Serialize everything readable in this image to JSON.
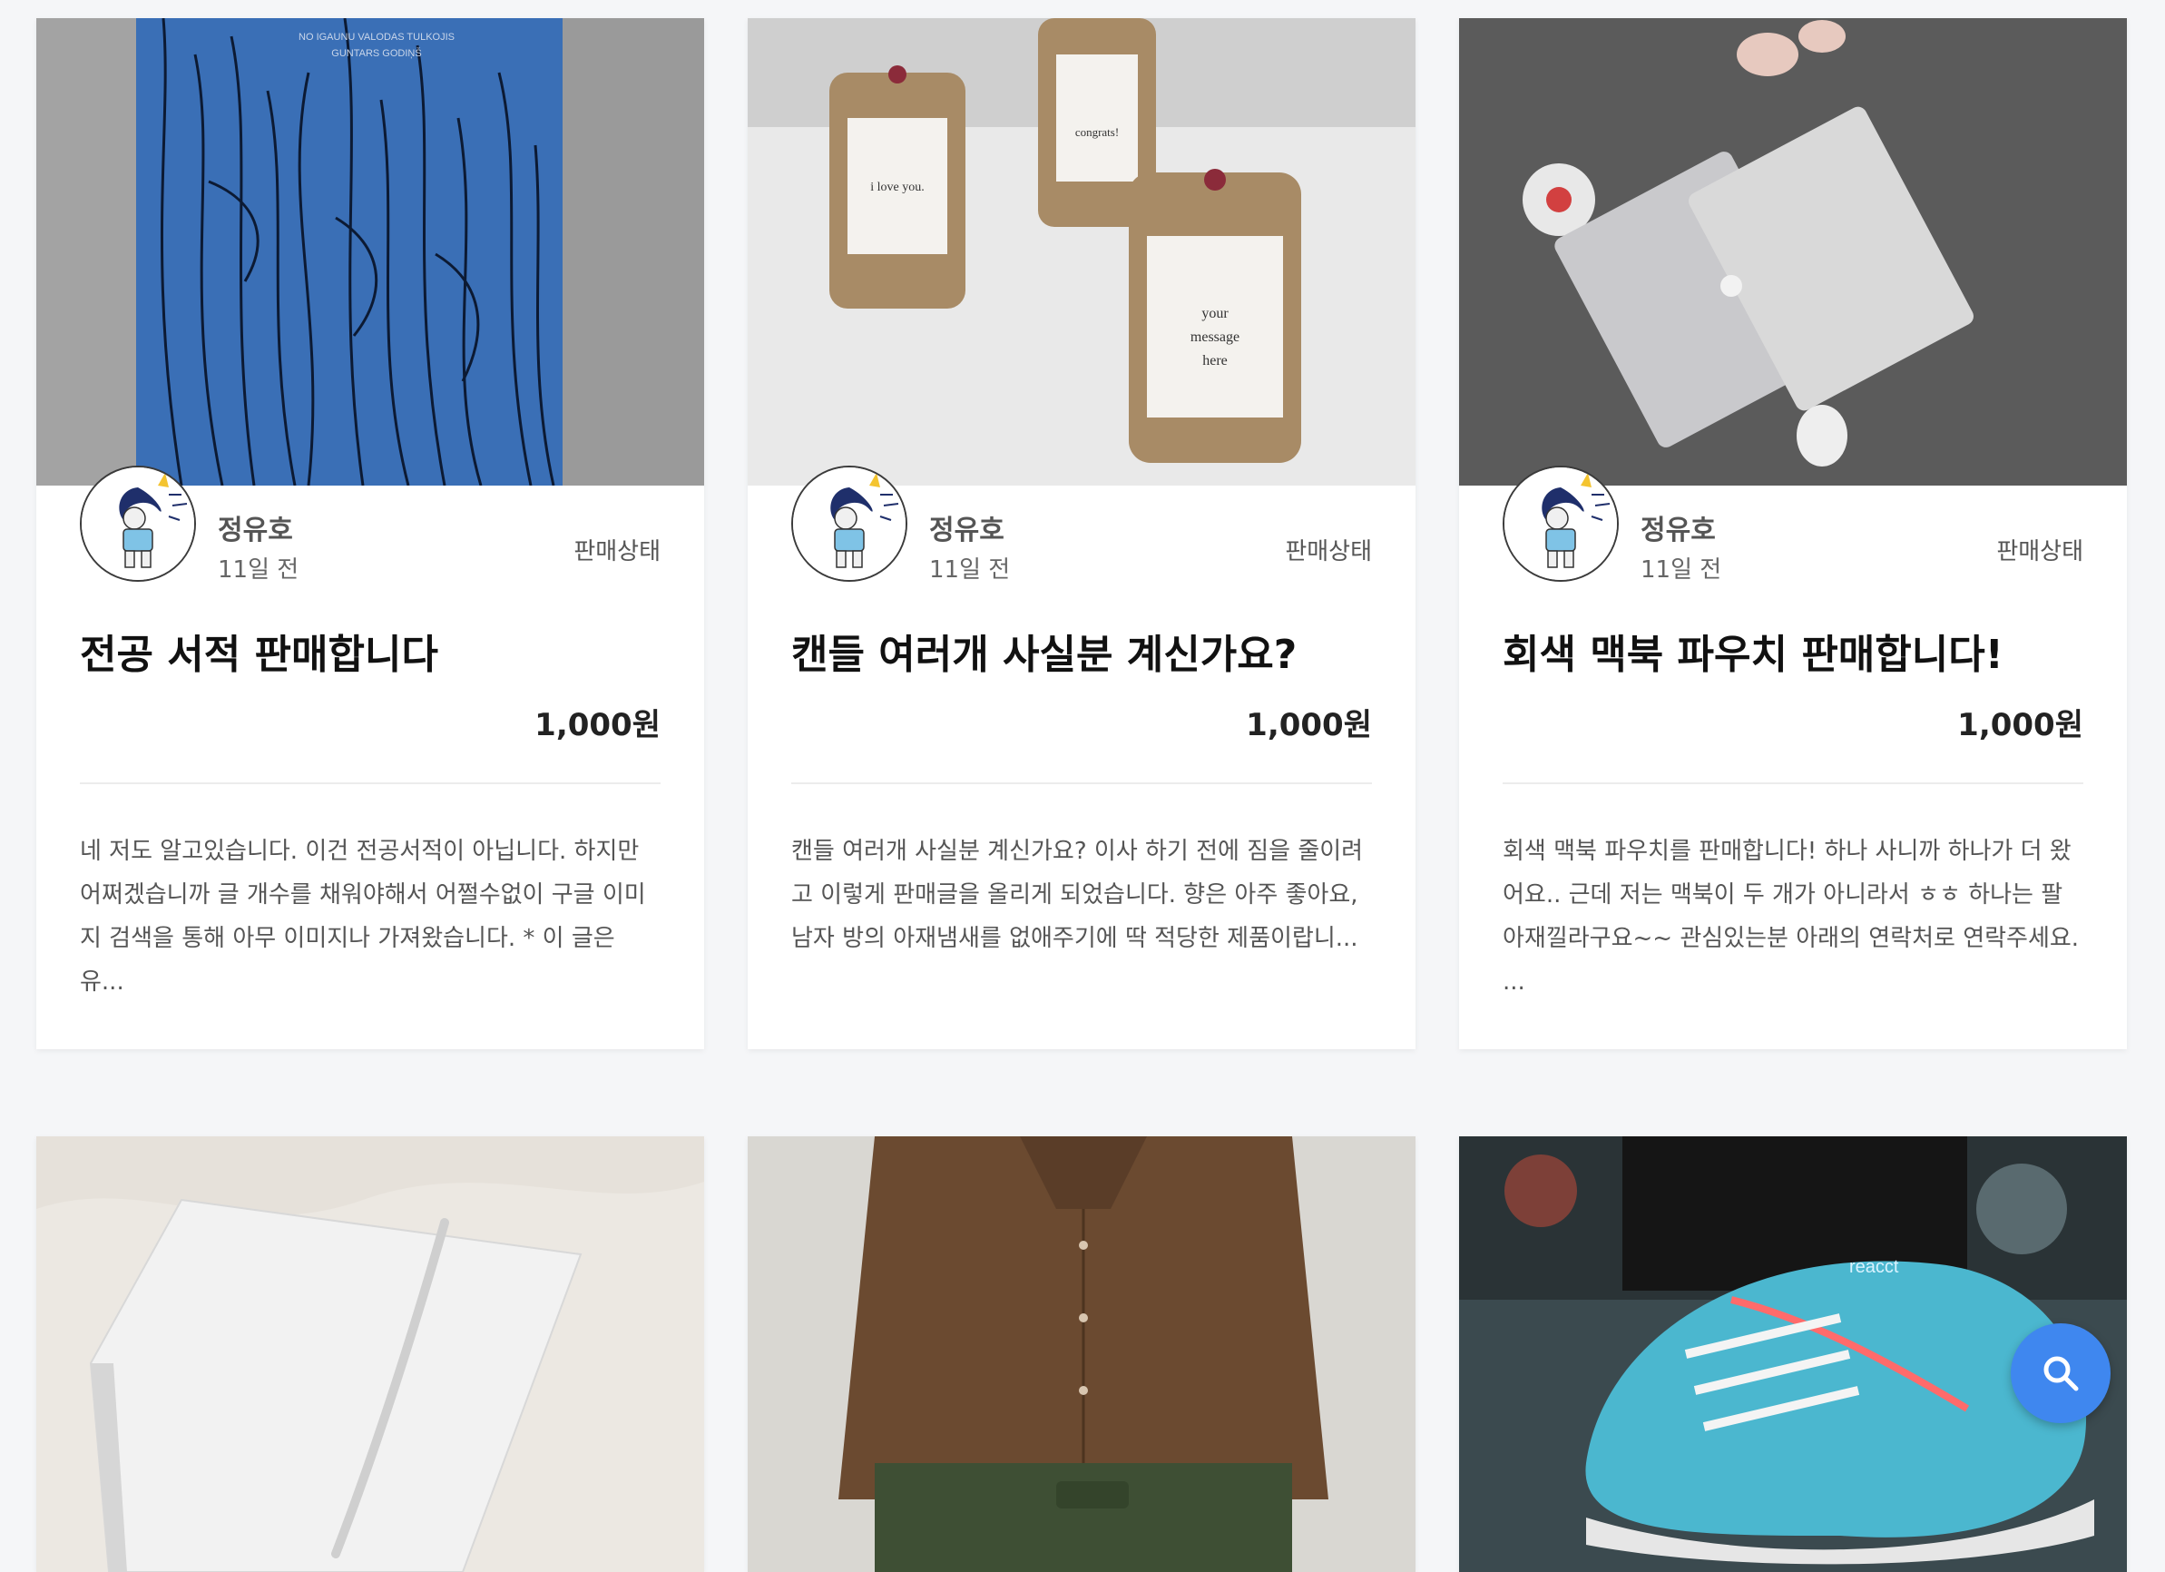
{
  "cards": [
    {
      "author": "정유호",
      "time": "11일 전",
      "status": "판매상태",
      "title": "전공 서적 판매합니다",
      "price": "1,000원",
      "description": "네 저도 알고있습니다. 이건 전공서적이 아닙니다. 하지만 어쩌겠습니까 글 개수를 채워야해서 어쩔수없이 구글 이미지 검색을 통해 아무 이미지나 가져왔습니다. * 이 글은 유...",
      "book_cover_text": [
        "NO IGAUNU VALODAS TULKOJIS",
        "GUNTARS GODIŅŠ"
      ]
    },
    {
      "author": "정유호",
      "time": "11일 전",
      "status": "판매상태",
      "title": "캔들 여러개 사실분 계신가요?",
      "price": "1,000원",
      "description": "캔들 여러개 사실분 계신가요? 이사 하기 전에 짐을 줄이려고 이렇게 판매글을 올리게 되었습니다. 향은 아주 좋아요, 남자 방의 아재냄새를 없애주기에 딱 적당한 제품이랍니...",
      "candle_labels": [
        "i love you.",
        "congrats!",
        "your",
        "message",
        "here"
      ]
    },
    {
      "author": "정유호",
      "time": "11일 전",
      "status": "판매상태",
      "title": "회색 맥북 파우치 판매합니다!",
      "price": "1,000원",
      "description": "회색 맥북 파우치를 판매합니다! 하나 사니까 하나가 더 왔어요.. 근데 저는 맥북이 두 개가 아니라서 ㅎㅎ 하나는 팔아재낄라구요~~ 관심있는분 아래의 연락처로 연락주세요. ..."
    },
    {
      "image": "tablet-box-photo"
    },
    {
      "image": "brown-shirt-photo"
    },
    {
      "image": "sneaker-photo",
      "shoe_text": "reacct"
    }
  ],
  "fab": {
    "icon": "search-icon",
    "color": "#3f87ef"
  },
  "colors": {
    "background": "#f5f6f8",
    "card": "#ffffff",
    "title": "#111111"
  }
}
